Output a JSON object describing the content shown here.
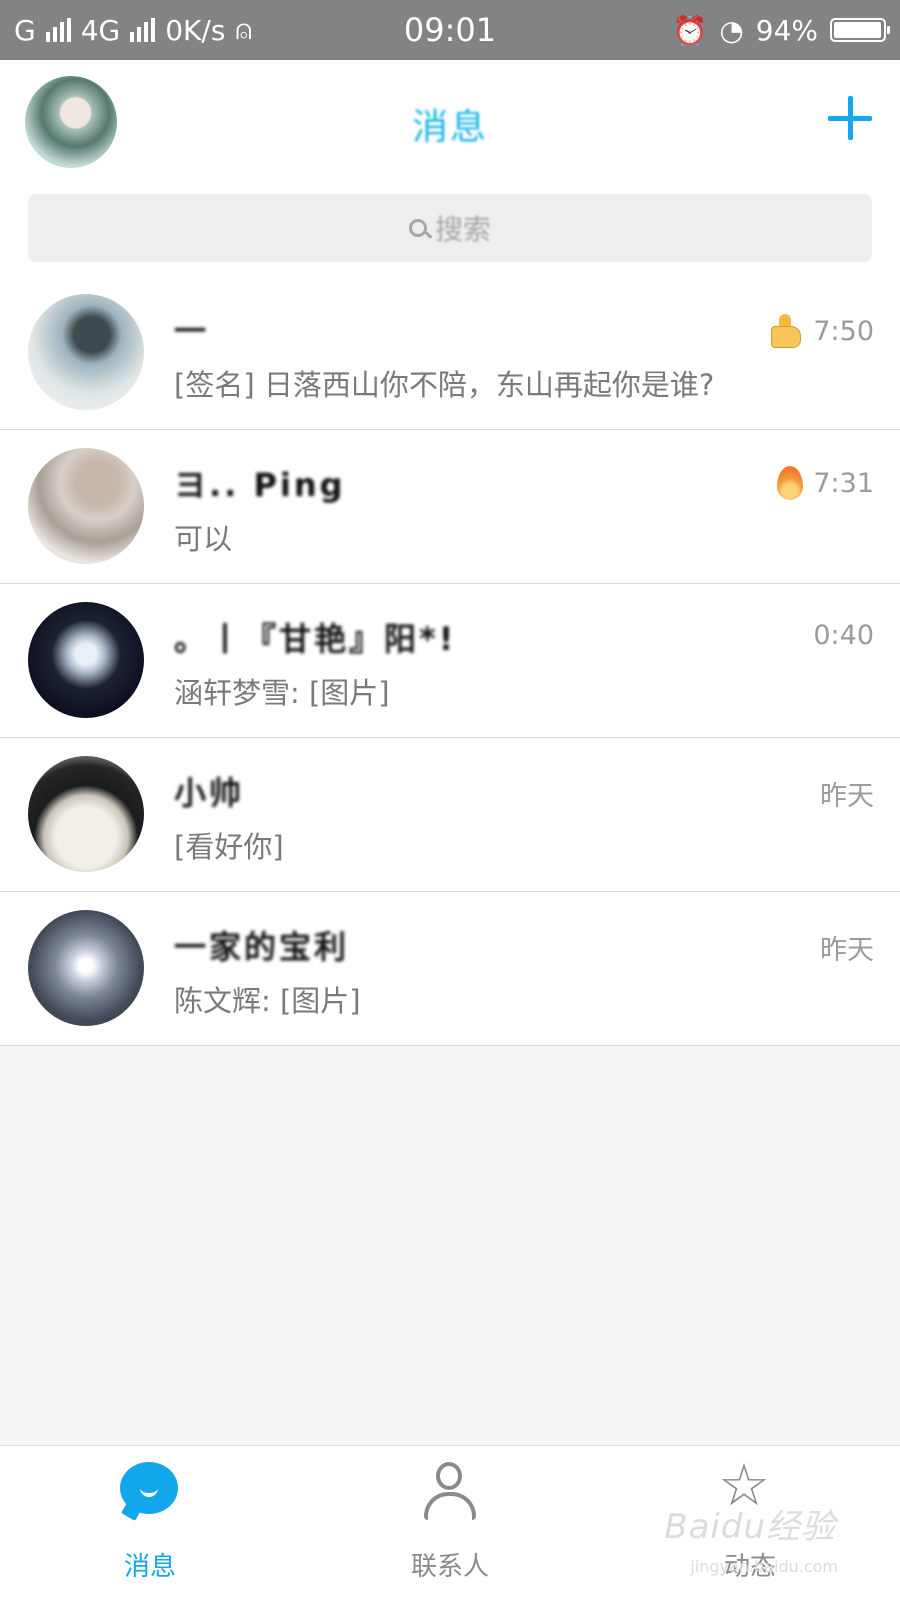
{
  "status_bar": {
    "carrier": "G",
    "network": "4G",
    "speed": "0K/s",
    "time": "09:01",
    "battery": "94%"
  },
  "header": {
    "title": "消息",
    "add_icon": "plus-icon"
  },
  "search": {
    "placeholder": "搜索"
  },
  "conversations": [
    {
      "name": "一",
      "preview": "[签名] 日落西山你不陪，东山再起你是谁?",
      "time": "7:50",
      "badge_icon": "thumbs-up-icon"
    },
    {
      "name": "ヨ.. Ping",
      "preview": "可以",
      "time": "7:31",
      "badge_icon": "flame-icon"
    },
    {
      "name": "。丨『甘艳』阳*!",
      "preview": "涵轩梦雪: [图片]",
      "time": "0:40"
    },
    {
      "name": "小帅",
      "preview": "[看好你]",
      "time": "昨天"
    },
    {
      "name": "一家的宝利",
      "preview": "陈文辉: [图片]",
      "time": "昨天"
    }
  ],
  "tabbar": {
    "messages": "消息",
    "contacts": "联系人",
    "feed": "动态"
  },
  "watermark": {
    "brand": "Baidu经验",
    "url": "jingyan.baidu.com"
  },
  "colors": {
    "accent": "#12a6ea",
    "status_bar": "#838385"
  }
}
